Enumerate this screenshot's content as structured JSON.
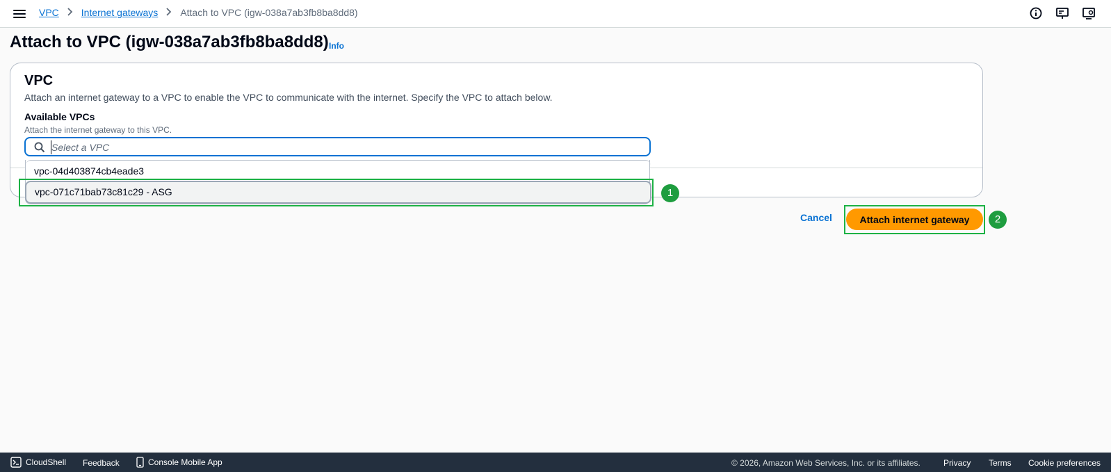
{
  "nav": {
    "breadcrumbs": [
      {
        "label": "VPC"
      },
      {
        "label": "Internet gateways"
      },
      {
        "label": "Attach to VPC (igw-038a7ab3fb8ba8dd8)"
      }
    ],
    "icons": [
      "menu-icon",
      "info-circle-icon",
      "notifications-icon",
      "settings-icon"
    ]
  },
  "page": {
    "title": "Attach to VPC (igw-038a7ab3fb8ba8dd8)",
    "info_link": "Info"
  },
  "vpc_section": {
    "title": "VPC",
    "description": "Attach an internet gateway to a VPC to enable the VPC to communicate with the internet. Specify the VPC to attach below.",
    "field_label": "Available VPCs",
    "field_description": "Attach the internet gateway to this VPC.",
    "search_placeholder": "Select a VPC",
    "search_value": "",
    "options": [
      {
        "label": "vpc-04d403874cb4eade3"
      },
      {
        "label": "vpc-071c71bab73c81c29 - ASG"
      }
    ]
  },
  "actions": {
    "cancel_label": "Cancel",
    "attach_label": "Attach internet gateway"
  },
  "annotations": {
    "badge_1": "1",
    "badge_2": "2",
    "highlight_color": "#1db245",
    "badge_color": "#1e9d3f"
  },
  "footer": {
    "cloudshell": "CloudShell",
    "feedback": "Feedback",
    "mobile_app": "Console Mobile App",
    "copyright": "© 2026, Amazon Web Services, Inc. or its affiliates.",
    "privacy": "Privacy",
    "terms": "Terms",
    "cookies": "Cookie preferences"
  },
  "colors": {
    "primary_button": "#ff9900",
    "link": "#0972d3",
    "footer_bg": "#232f3e"
  }
}
